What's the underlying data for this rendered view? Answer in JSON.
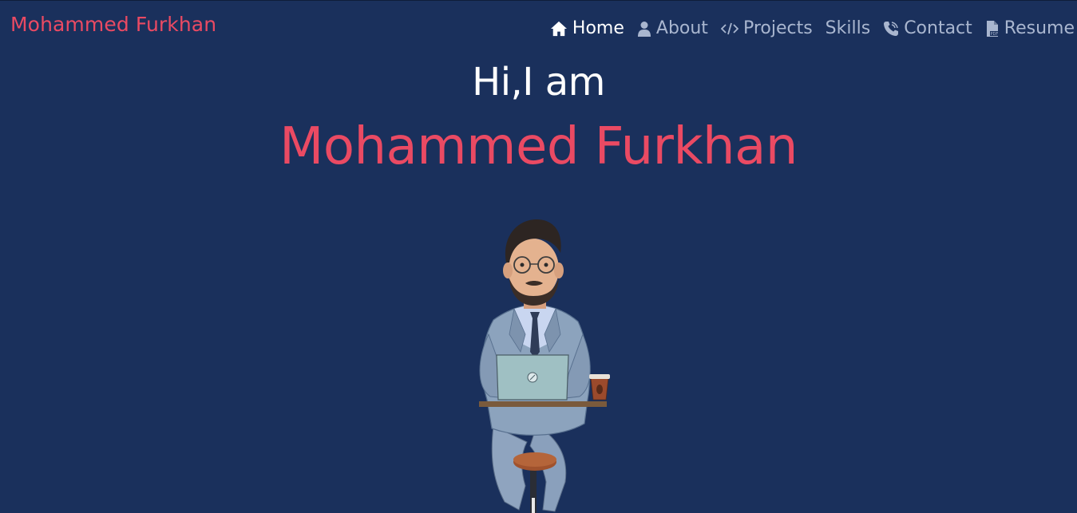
{
  "header": {
    "brand": "Mohammed Furkhan"
  },
  "nav": {
    "items": [
      {
        "label": "Home",
        "icon": "home-icon",
        "active": true
      },
      {
        "label": "About",
        "icon": "user-icon",
        "active": false
      },
      {
        "label": "Projects",
        "icon": "code-icon",
        "active": false
      },
      {
        "label": "Skills",
        "icon": "",
        "active": false
      },
      {
        "label": "Contact",
        "icon": "phone-icon",
        "active": false
      },
      {
        "label": "Resume",
        "icon": "pdf-file-icon",
        "active": false
      }
    ]
  },
  "hero": {
    "greeting": "Hi,I am",
    "name": "Mohammed Furkhan",
    "avatar_icon": "developer-avatar-illustration"
  },
  "colors": {
    "background": "#1a305c",
    "accent": "#ea4a63",
    "nav_text": "#a9b6cf",
    "active_text": "#ffffff"
  }
}
